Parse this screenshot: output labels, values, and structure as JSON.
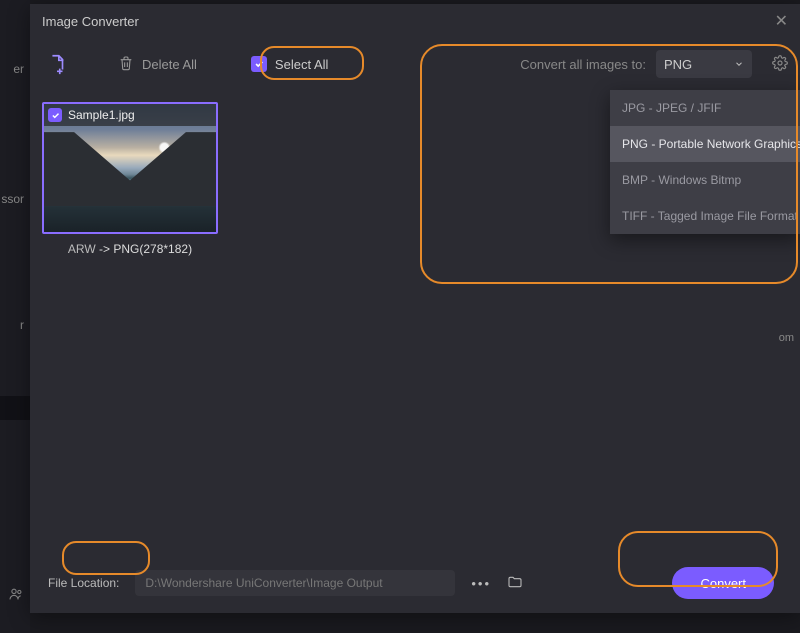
{
  "title": "Image Converter",
  "toolbar": {
    "delete_all": "Delete All",
    "select_all": "Select All",
    "convert_label": "Convert all images to:",
    "format_selected": "PNG"
  },
  "dropdown": {
    "options": [
      "JPG - JPEG / JFIF",
      "PNG - Portable Network Graphics",
      "BMP - Windows Bitmp",
      "TIFF - Tagged Image File Format"
    ],
    "active_index": 1
  },
  "thumb": {
    "filename": "Sample1.jpg",
    "caption_prefix": "ARW",
    "caption_suffix": " -> PNG(278*182)"
  },
  "footer": {
    "label": "File Location:",
    "path": "D:\\Wondershare UniConverter\\Image Output",
    "convert": "Convert"
  },
  "side": {
    "frag1": "er",
    "frag2": "ssor",
    "frag3": "r"
  },
  "corner": "om"
}
